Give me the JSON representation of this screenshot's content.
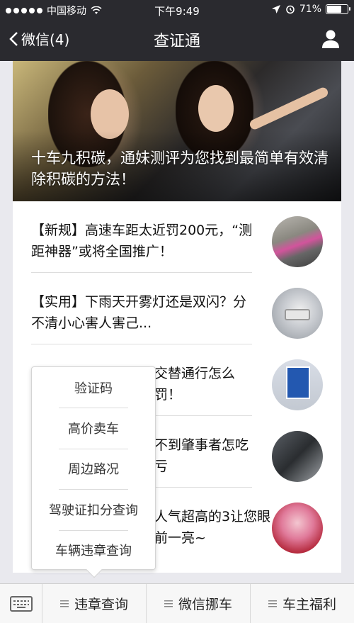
{
  "status_bar": {
    "carrier": "中国移动",
    "time": "下午9:49",
    "battery_percent": "71%",
    "battery_level": 0.71
  },
  "nav": {
    "back_label": "微信(4)",
    "title": "查证通"
  },
  "banner": {
    "caption": "十车九积碳，通妹测评为您找到最简单有效清除积碳的方法！"
  },
  "articles": [
    {
      "title": "【新规】高速车距太近罚200元，“测距神器”或将全国推广！"
    },
    {
      "title": "【实用】下雨天开雾灯还是双闪？分不清小心害人害己..."
    },
    {
      "title": "交替通行怎么罚！"
    },
    {
      "title": "不到肇事者怎吃亏"
    },
    {
      "title": "人气超高的3让您眼前一亮~"
    }
  ],
  "popup_menu": {
    "items": [
      "验证码",
      "高价卖车",
      "周边路况",
      "驾驶证扣分查询",
      "车辆违章查询"
    ]
  },
  "bottom_menu": {
    "tabs": [
      "违章查询",
      "微信挪车",
      "车主福利"
    ]
  },
  "colors": {
    "nav_bg": "#2a2a2f",
    "page_bg": "#e9e9ee",
    "card_bg": "#ffffff"
  }
}
